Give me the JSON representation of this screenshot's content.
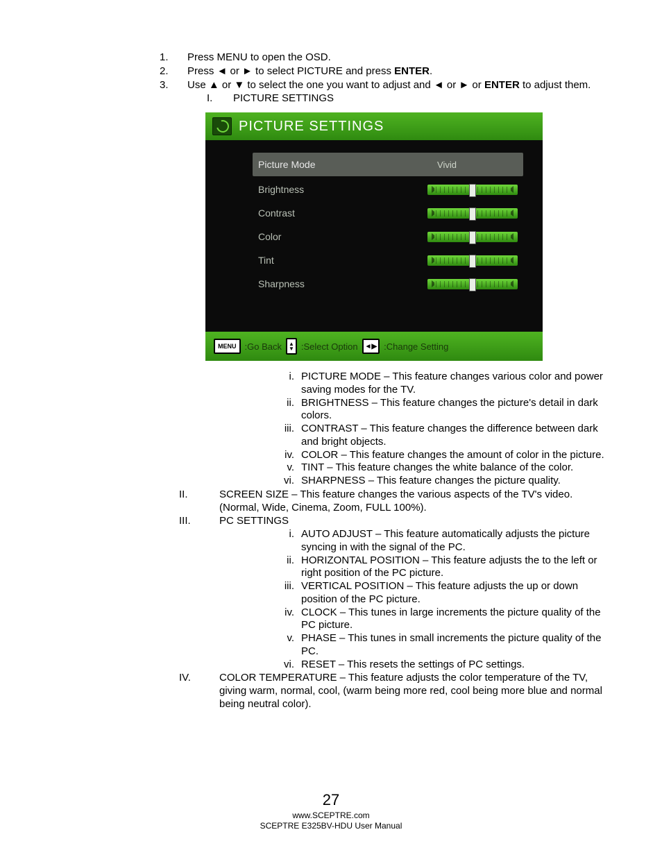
{
  "steps": {
    "s1": {
      "num": "1.",
      "text": "Press MENU to open the OSD."
    },
    "s2": {
      "num": "2.",
      "prefix": "Press ◄ or ► to select PICTURE and press ",
      "bold": "ENTER",
      "suffix": "."
    },
    "s3": {
      "num": "3.",
      "prefix": "Use ▲ or ▼ to select the one you want to adjust and ◄ or ► or ",
      "bold": "ENTER",
      "suffix": " to adjust them."
    },
    "s3I": {
      "num": "I.",
      "text": "PICTURE SETTINGS"
    }
  },
  "osd": {
    "title": "PICTURE SETTINGS",
    "rows": {
      "mode": {
        "label": "Picture Mode",
        "value": "Vivid"
      },
      "brightness": {
        "label": "Brightness"
      },
      "contrast": {
        "label": "Contrast"
      },
      "color": {
        "label": "Color"
      },
      "tint": {
        "label": "Tint"
      },
      "sharpness": {
        "label": "Sharpness"
      }
    },
    "footer": {
      "menu_key": "MENU",
      "go_back": ":Go Back",
      "select_option": ":Select Option",
      "change_setting": ":Change Setting"
    }
  },
  "picture_items": {
    "i": {
      "num": "i.",
      "text": "PICTURE MODE – This feature changes various color and power saving modes for the TV."
    },
    "ii": {
      "num": "ii.",
      "text": "BRIGHTNESS – This feature changes the picture's detail in dark colors."
    },
    "iii": {
      "num": "iii.",
      "text": "CONTRAST – This feature changes the difference between dark and bright objects."
    },
    "iv": {
      "num": "iv.",
      "text": "COLOR – This feature changes the amount of color in the picture."
    },
    "v": {
      "num": "v.",
      "text": "TINT – This feature changes the white balance of the color."
    },
    "vi": {
      "num": "vi.",
      "text": "SHARPNESS – This feature changes the picture quality."
    }
  },
  "sections": {
    "II": {
      "num": "II.",
      "text": "SCREEN SIZE – This feature changes the various aspects of the TV's video.  (Normal, Wide, Cinema, Zoom, FULL 100%)."
    },
    "III": {
      "num": "III.",
      "text": "PC SETTINGS"
    },
    "IV": {
      "num": "IV.",
      "text": "COLOR TEMPERATURE – This feature adjusts the color temperature of the TV, giving warm, normal, cool, (warm being more red, cool being more blue and normal being neutral color)."
    }
  },
  "pc_items": {
    "i": {
      "num": "i.",
      "text": "AUTO ADJUST – This feature automatically adjusts the picture syncing in with the signal of the PC."
    },
    "ii": {
      "num": "ii.",
      "text": "HORIZONTAL POSITION – This feature adjusts the to the left or right position of the PC picture."
    },
    "iii": {
      "num": "iii.",
      "text": "VERTICAL POSITION – This feature adjusts the up or down position of the PC picture."
    },
    "iv": {
      "num": "iv.",
      "text": "CLOCK – This tunes in large increments the picture quality of the PC picture."
    },
    "v": {
      "num": "v.",
      "text": "PHASE – This tunes in small increments the picture quality of the PC."
    },
    "vi": {
      "num": "vi.",
      "text": "RESET – This resets the settings of PC settings."
    }
  },
  "footer": {
    "page": "27",
    "url": "www.SCEPTRE.com",
    "manual": "SCEPTRE E325BV-HDU User Manual"
  }
}
